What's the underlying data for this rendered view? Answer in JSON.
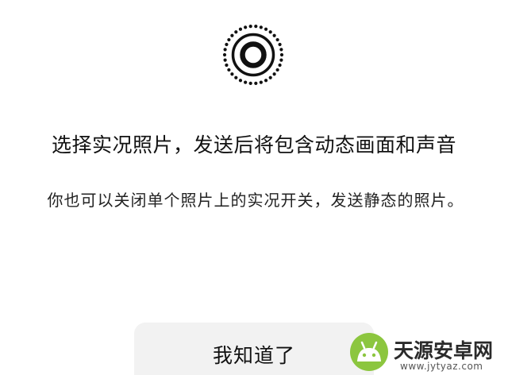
{
  "dialog": {
    "icon": "live-photo-icon",
    "title": "选择实况照片，发送后将包含动态画面和声音",
    "description": "你也可以关闭单个照片上的实况开关，发送静态的照片。",
    "confirm_label": "我知道了"
  },
  "watermark": {
    "logo": "android-logo-icon",
    "name": "天源安卓网",
    "url": "www.jytyaz.com"
  },
  "colors": {
    "background": "#ffffff",
    "text": "#111111",
    "button_bg": "#f2f2f2",
    "logo_green": "#8cc63f"
  }
}
